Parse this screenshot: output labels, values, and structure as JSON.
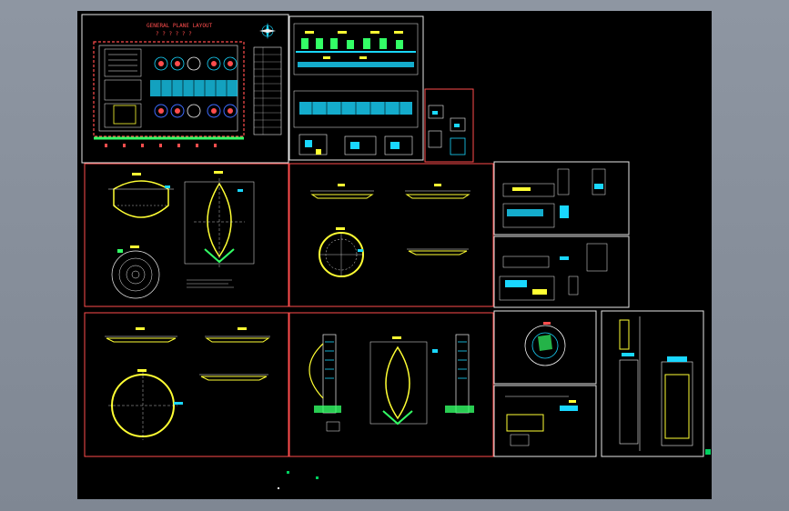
{
  "app": {
    "layout_title": "GENERAL PLANE LAYOUT",
    "layout_subtitle": "? ? ? ? ? ?"
  },
  "colors": {
    "background": "#000000",
    "frame": "#ff4d4d",
    "line_cyan": "#19d7ff",
    "line_yellow": "#ffff33",
    "line_green": "#33ff66",
    "line_blue": "#3d6bff",
    "line_white": "#f0f0f0",
    "grip": "#00d060"
  },
  "icons": {
    "north_arrow": "compass-icon",
    "grip": "square-grip-icon"
  }
}
